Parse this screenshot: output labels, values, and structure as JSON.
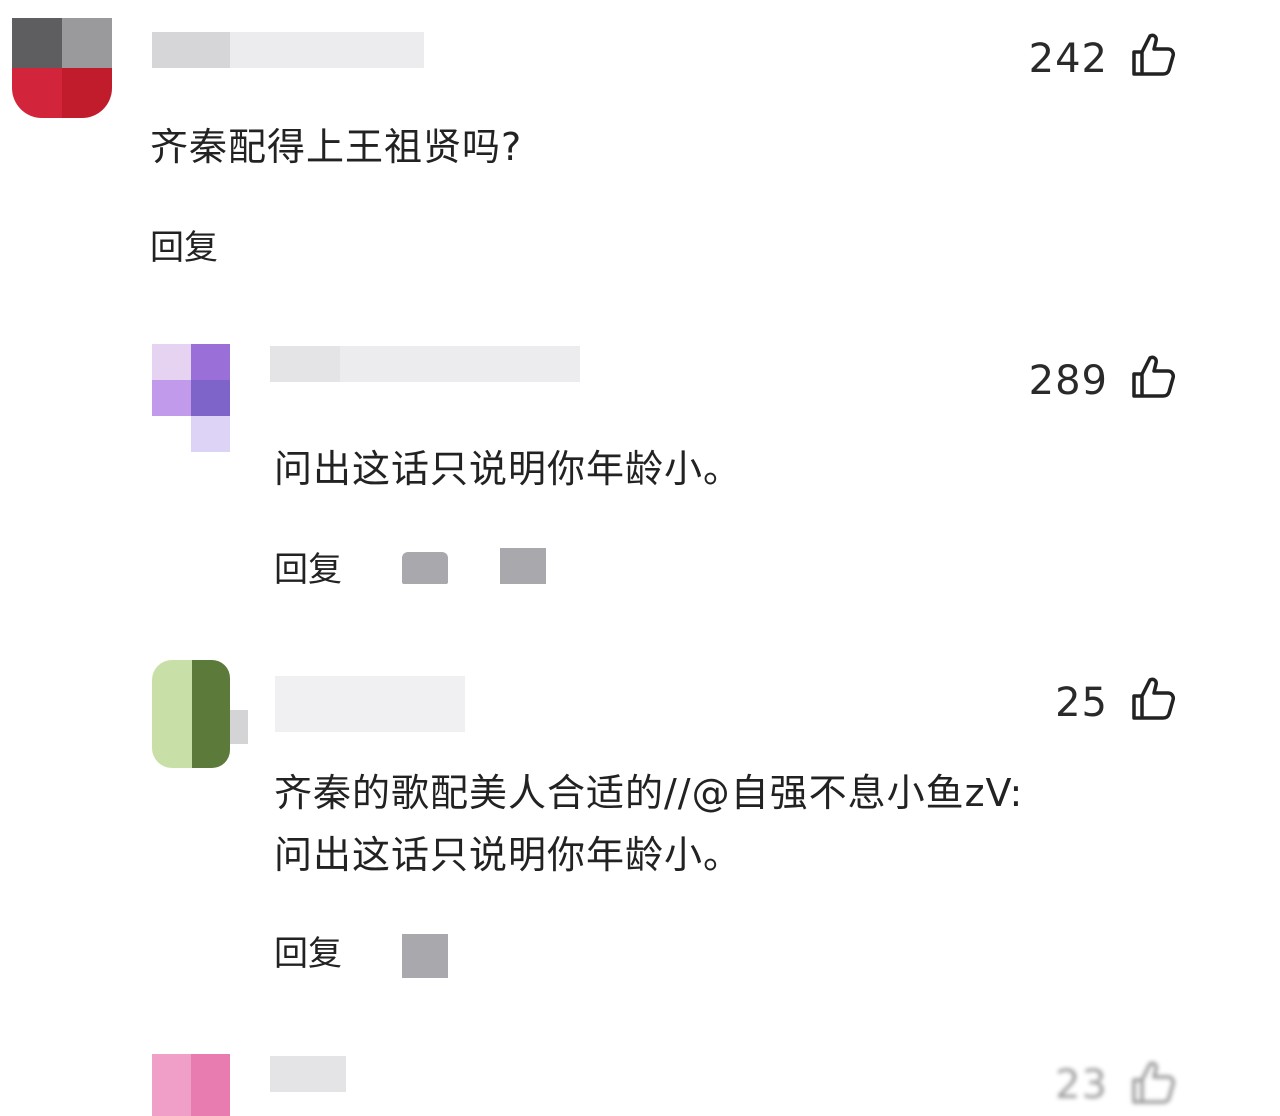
{
  "comments": [
    {
      "likes": "242",
      "text": "齐秦配得上王祖贤吗?",
      "reply_label": "回复",
      "avatar_colors": [
        "#5e5e60",
        "#9a9a9c",
        "#d2243a",
        "#c01c2c"
      ]
    },
    {
      "likes": "289",
      "text": "问出这话只说明你年龄小。",
      "reply_label": "回复",
      "avatar_colors": [
        "#e6d3f2",
        "#9a6fd8",
        "#c29aec",
        "#7e64c8"
      ]
    },
    {
      "likes": "25",
      "text_line1": "齐秦的歌配美人合适的//@自强不息小鱼zV:",
      "text_line2": "问出这话只说明你年龄小。",
      "reply_label": "回复",
      "avatar_colors": [
        "#c8e0a8",
        "#5c7a3a",
        "#98b470",
        "#3e5a26"
      ]
    },
    {
      "likes": "23",
      "avatar_colors": [
        "#f0a0c8",
        "#e87bb0"
      ]
    }
  ],
  "icons": {
    "like": "thumbs-up-icon"
  }
}
